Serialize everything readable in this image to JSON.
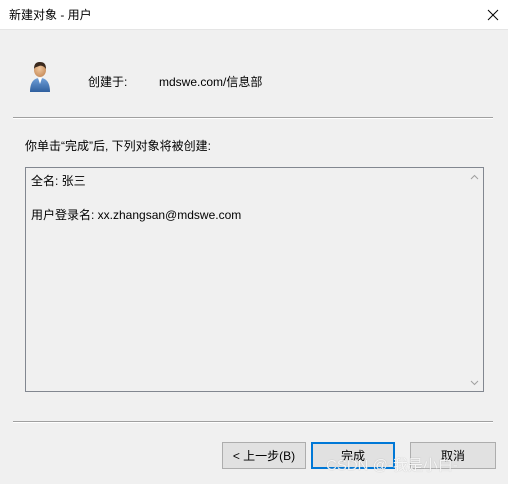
{
  "window": {
    "title": "新建对象 - 用户"
  },
  "header": {
    "created_in_label": "创建于:",
    "created_in_value": "mdswe.com/信息部"
  },
  "instruction": "你单击“完成”后, 下列对象将被创建:",
  "summary": {
    "full_name": "全名: 张三",
    "logon_name": "用户登录名: xx.zhangsan@mdswe.com"
  },
  "buttons": {
    "back": "< 上一步(B)",
    "finish": "完成",
    "cancel": "取消"
  },
  "watermark": "CSDN @-我是小白-",
  "colors": {
    "focus_border": "#0078d7",
    "background": "#f0f0f0"
  }
}
